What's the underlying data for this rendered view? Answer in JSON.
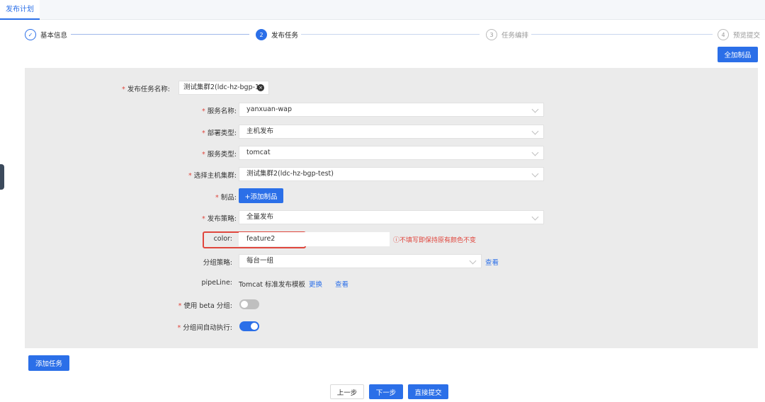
{
  "header": {
    "tab_label": "发布计划"
  },
  "steps": [
    {
      "label": "基本信息",
      "marker": "✓",
      "state": "done"
    },
    {
      "label": "发布任务",
      "marker": "2",
      "state": "active"
    },
    {
      "label": "任务编排",
      "marker": "3",
      "state": "wait"
    },
    {
      "label": "预览提交",
      "marker": "4",
      "state": "wait"
    }
  ],
  "buttons": {
    "add_all_products": "全加制品",
    "add_product": "+添加制品",
    "add_task": "添加任务",
    "prev": "上一步",
    "next": "下一步",
    "submit": "直接提交"
  },
  "form": {
    "task_name": {
      "label": "发布任务名称:",
      "value": "测试集群2(ldc-hz-bgp-1"
    },
    "service_name": {
      "label": "服务名称:",
      "value": "yanxuan-wap"
    },
    "deploy_type": {
      "label": "部署类型:",
      "value": "主机发布"
    },
    "service_type": {
      "label": "服务类型:",
      "value": "tomcat"
    },
    "host_cluster": {
      "label": "选择主机集群:",
      "value": "测试集群2(ldc-hz-bgp-test)"
    },
    "product": {
      "label": "制品:"
    },
    "strategy": {
      "label": "发布策略:",
      "value": "全量发布"
    },
    "color": {
      "label": "color:",
      "value": "feature2",
      "hint": "ⓘ不填写即保持原有颜色不变"
    },
    "group_strategy": {
      "label": "分组策略:",
      "value": "每台一组",
      "view": "查看"
    },
    "pipeline": {
      "label": "pipeLine:",
      "value": "Tomcat 标准发布模板",
      "change": "更换",
      "view": "查看"
    },
    "beta_group": {
      "label": "使用 beta 分组:",
      "enabled": false
    },
    "auto_exec": {
      "label": "分组间自动执行:",
      "enabled": true
    }
  },
  "colors": {
    "primary": "#2b6fe8",
    "required": "#e0463d",
    "highlight": "#e0463d",
    "panel": "#ebebeb"
  }
}
